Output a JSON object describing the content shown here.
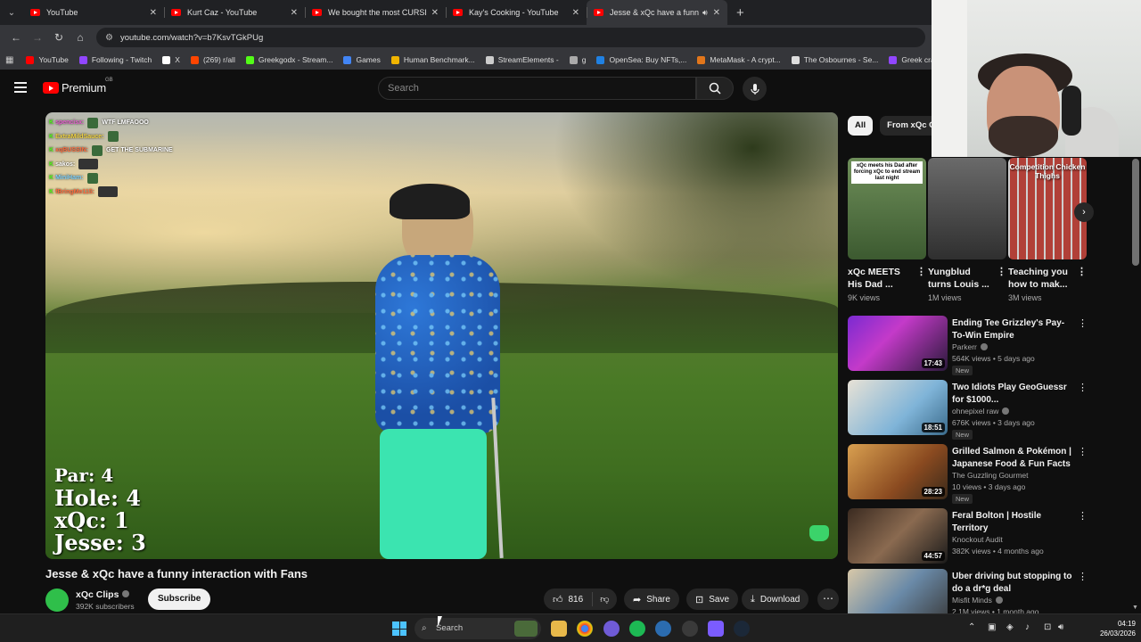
{
  "browser": {
    "tabs": [
      {
        "title": "YouTube",
        "active": false
      },
      {
        "title": "Kurt Caz - YouTube",
        "active": false
      },
      {
        "title": "We bought the most CURSED T",
        "active": false
      },
      {
        "title": "Kay's Cooking - YouTube",
        "active": false
      },
      {
        "title": "Jesse & xQc have a funny in",
        "active": true
      }
    ],
    "url": "youtube.com/watch?v=b7KsvTGkPUg",
    "bookmarks": [
      {
        "label": "YouTube",
        "color": "#ff0000"
      },
      {
        "label": "Following - Twitch",
        "color": "#9146ff"
      },
      {
        "label": "X",
        "color": "#ffffff"
      },
      {
        "label": "(269) r/all",
        "color": "#ff4500"
      },
      {
        "label": "Greekgodx - Stream...",
        "color": "#53fc18"
      },
      {
        "label": "Games",
        "color": "#4285f4"
      },
      {
        "label": "Human Benchmark...",
        "color": "#f0b400"
      },
      {
        "label": "StreamElements -",
        "color": "#cccccc"
      },
      {
        "label": "g",
        "color": "#aaaaaa"
      },
      {
        "label": "OpenSea: Buy NFTs,...",
        "color": "#2081e2"
      },
      {
        "label": "MetaMask - A crypt...",
        "color": "#e2761b"
      },
      {
        "label": "The Osbournes - Se...",
        "color": "#dddddd"
      },
      {
        "label": "Greek cracked - Twi...",
        "color": "#9146ff"
      }
    ]
  },
  "youtube": {
    "logo_text": "Premium",
    "country_code": "GB",
    "search_placeholder": "Search"
  },
  "player": {
    "chat": [
      {
        "name": "spencisx:",
        "msg": "WTF LMFAOOO",
        "color": "#e85dd0"
      },
      {
        "name": "ExtraMildSauce:",
        "msg": "",
        "color": "#f0d240"
      },
      {
        "name": "xqBUSSIN:",
        "msg": "GET THE SUBMARINE",
        "color": "#ff6a3d"
      },
      {
        "name": "sakos:",
        "msg": "",
        "color": "#ffffff"
      },
      {
        "name": "MiniHam:",
        "msg": "",
        "color": "#7dd3ff"
      },
      {
        "name": "fBringMe115:",
        "msg": "",
        "color": "#ff6a3d"
      }
    ],
    "scoreboard": {
      "par": "Par: 4",
      "hole": "Hole: 4",
      "xqc": "xQc: 1",
      "jesse": "Jesse: 3"
    }
  },
  "video": {
    "title": "Jesse & xQc have a funny interaction with Fans",
    "channel": "xQc Clips",
    "subscribers": "392K subscribers",
    "subscribe_label": "Subscribe",
    "likes": "816",
    "share_label": "Share",
    "save_label": "Save",
    "download_label": "Download"
  },
  "sidebar": {
    "chips": [
      "All",
      "From xQc Cli"
    ],
    "shorts": [
      {
        "title": "xQc MEETS His Dad ...",
        "views": "9K views",
        "caption": "xQc meets his Dad after forcing xQc to end stream last night",
        "style": "white"
      },
      {
        "title": "Yungblud turns Louis ...",
        "views": "1M views",
        "caption": "",
        "style": "none"
      },
      {
        "title": "Teaching you how to mak...",
        "views": "3M views",
        "caption": "Competition Chicken Thighs",
        "style": "white"
      }
    ],
    "recommended": [
      {
        "title": "Ending Tee Grizzley's Pay-To-Win Empire",
        "channel": "Parkerr",
        "verified": true,
        "meta": "564K views • 5 days ago",
        "new": "New",
        "duration": "17:43"
      },
      {
        "title": "Two Idiots Play GeoGuessr for $1000...",
        "channel": "ohnepixel raw",
        "verified": true,
        "meta": "676K views • 3 days ago",
        "new": "New",
        "duration": "18:51"
      },
      {
        "title": "Grilled Salmon & Pokémon | Japanese Food & Fun Facts",
        "channel": "The Guzzling Gourmet",
        "verified": false,
        "meta": "10 views • 3 days ago",
        "new": "New",
        "duration": "28:23"
      },
      {
        "title": "Feral Bolton | Hostile Territory",
        "channel": "Knockout Audit",
        "verified": false,
        "meta": "382K views • 4 months ago",
        "new": "",
        "duration": "44:57"
      },
      {
        "title": "Uber driving but stopping to do a dr*g deal",
        "channel": "Misfit Minds",
        "verified": true,
        "meta": "2.1M views • 1 month ago",
        "new": "",
        "duration": ""
      }
    ]
  },
  "taskbar": {
    "search_placeholder": "Search",
    "time": "04:19",
    "date": "26/03/2026"
  }
}
